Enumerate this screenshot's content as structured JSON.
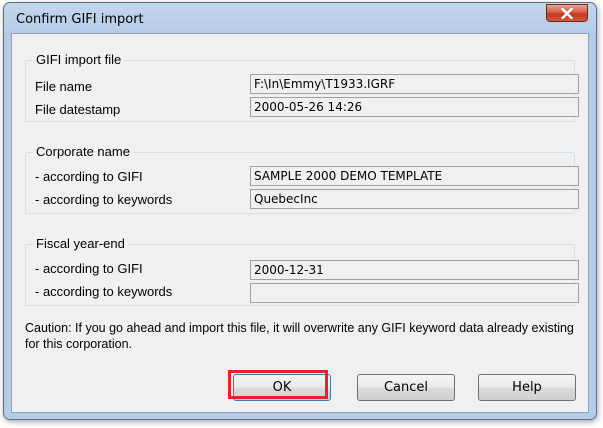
{
  "window": {
    "title": "Confirm GIFI import",
    "close_icon": "close-x-icon"
  },
  "gifi_file": {
    "group_label": "GIFI import file",
    "file_name_label": "File name",
    "file_name_value": "F:\\In\\Emmy\\T1933.IGRF",
    "datestamp_label": "File datestamp",
    "datestamp_value": "2000-05-26 14:26"
  },
  "corporate_name": {
    "group_label": "Corporate name",
    "gifi_label": "- according to GIFI",
    "gifi_value": "SAMPLE 2000 DEMO TEMPLATE",
    "keywords_label": "- according to keywords",
    "keywords_value": "QuebecInc"
  },
  "fiscal_year_end": {
    "group_label": "Fiscal year-end",
    "gifi_label": "- according to GIFI",
    "gifi_value": "2000-12-31",
    "keywords_label": "- according to keywords",
    "keywords_value": ""
  },
  "caution_text": "Caution: If you go ahead and import this file, it will overwrite any GIFI keyword data already existing for this corporation.",
  "buttons": {
    "ok": "OK",
    "cancel": "Cancel",
    "help": "Help"
  },
  "colors": {
    "highlight": "#e8202a",
    "close_button": "#c2391c",
    "frame": "#b6cbe6",
    "dialog_background": "#f0f0f0"
  }
}
